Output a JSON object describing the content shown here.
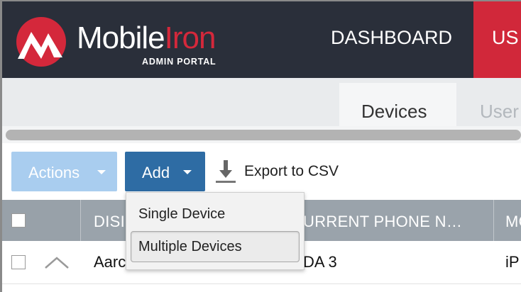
{
  "header": {
    "logo_word_1": "Mobile",
    "logo_word_2": "Iron",
    "logo_subtitle": "ADMIN PORTAL",
    "nav": [
      {
        "label": "DASHBOARD"
      },
      {
        "label": "US"
      }
    ]
  },
  "tabs": [
    {
      "label": "Devices",
      "active": true
    },
    {
      "label": "User",
      "active": false
    }
  ],
  "toolbar": {
    "actions_label": "Actions",
    "add_label": "Add",
    "export_label": "Export to CSV"
  },
  "add_menu": {
    "items": [
      {
        "label": "Single Device"
      },
      {
        "label": "Multiple Devices",
        "highlighted": true
      }
    ]
  },
  "table": {
    "columns": [
      "DISI",
      "URRENT PHONE N…",
      "MO"
    ],
    "rows": [
      {
        "cells": [
          "Aarc",
          "DA 3",
          "iP"
        ]
      }
    ]
  },
  "colors": {
    "header_bg": "#2a2f3a",
    "brand_red": "#d1283a",
    "add_button": "#2e6ca4",
    "actions_button": "#a9cdef",
    "table_header": "#9aa3ab"
  },
  "icons": [
    "mobileiron-logo-icon",
    "download-icon",
    "caret-down-icon",
    "chevron-up-icon"
  ]
}
